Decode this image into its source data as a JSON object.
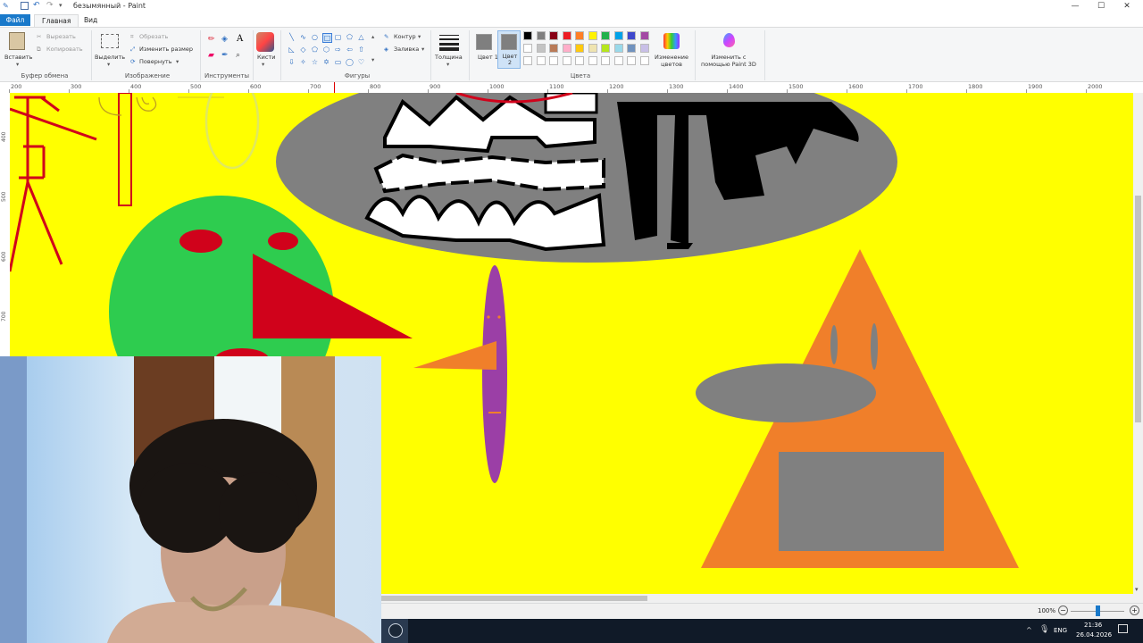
{
  "window": {
    "title": "безымянный - Paint",
    "controls": {
      "minimize": "—",
      "maximize": "☐",
      "close": "✕"
    }
  },
  "tabs": {
    "file": "Файл",
    "home": "Главная",
    "view": "Вид"
  },
  "ribbon": {
    "clipboard": {
      "paste": "Вставить",
      "cut": "Вырезать",
      "copy": "Копировать",
      "group": "Буфер обмена"
    },
    "image": {
      "select": "Выделить",
      "crop": "Обрезать",
      "resize": "Изменить размер",
      "rotate": "Повернуть",
      "group": "Изображение"
    },
    "tools": {
      "group": "Инструменты",
      "text_tool": "A"
    },
    "brushes": {
      "label": "Кисти"
    },
    "shapes": {
      "group": "Фигуры",
      "outline": "Контур",
      "fill": "Заливка"
    },
    "size": {
      "label": "Толщина"
    },
    "colors": {
      "color1": "Цвет 1",
      "color2": "Цвет 2",
      "edit_colors": "Изменение цветов",
      "edit_paint3d": "Изменить с помощью Paint 3D",
      "group": "Цвета",
      "color1_value": "#7f7f7f",
      "color2_value": "#7f7f7f",
      "palette_row1": [
        "#000000",
        "#7f7f7f",
        "#880015",
        "#ed1c24",
        "#ff7f27",
        "#fff200",
        "#22b14c",
        "#00a2e8",
        "#3f48cc",
        "#a349a4"
      ],
      "palette_row2": [
        "#ffffff",
        "#c3c3c3",
        "#b97a57",
        "#ffaec9",
        "#ffc90e",
        "#efe4b0",
        "#b5e61d",
        "#99d9ea",
        "#7092be",
        "#c8bfe7"
      ]
    }
  },
  "ruler": {
    "ticks": [
      "200",
      "300",
      "400",
      "500",
      "600",
      "700",
      "800",
      "900",
      "1000",
      "1100",
      "1200",
      "1300",
      "1400",
      "1500",
      "1600",
      "1700",
      "1800",
      "1900",
      "2000"
    ]
  },
  "vruler": {
    "ticks": [
      "400",
      "500",
      "600",
      "700"
    ]
  },
  "statusbar": {
    "zoom": "100%"
  },
  "taskbar": {
    "lang": "ENG",
    "time": "21:36",
    "date": "26.04.2026"
  },
  "colors": {
    "canvas_bg": "#ffff00",
    "accent": "#1979ca"
  }
}
